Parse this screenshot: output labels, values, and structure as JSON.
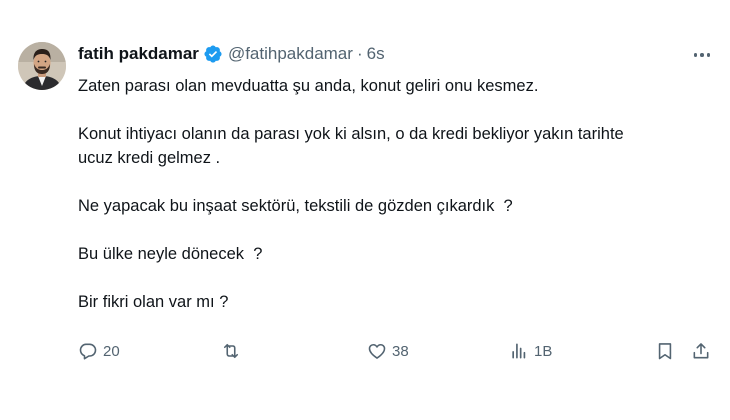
{
  "author": {
    "name": "fatih pakdamar",
    "handle": "@fatihpakdamar",
    "separator": "·",
    "time": "6s",
    "verified": true
  },
  "tweet": {
    "paragraphs": [
      "Zaten parası olan mevduatta şu anda, konut geliri onu kesmez.",
      "Konut ihtiyacı olanın da parası yok ki alsın, o da kredi bekliyor yakın tarihte\nucuz kredi gelmez .",
      "Ne yapacak bu inşaat sektörü, tekstili de gözden çıkardık  ?",
      "Bu ülke neyle dönecek  ?",
      "Bir fikri olan var mı ?"
    ]
  },
  "actions": {
    "replies": "20",
    "reposts": "",
    "likes": "38",
    "views": "1B"
  },
  "icons": {
    "verified": "verified-badge-icon",
    "more": "more-icon",
    "reply": "reply-icon",
    "repost": "repost-icon",
    "like": "like-icon",
    "views": "views-icon",
    "bookmark": "bookmark-icon",
    "share": "share-icon"
  },
  "colors": {
    "text": "#0f1419",
    "secondary": "#536471",
    "verified": "#1d9bf0",
    "background": "#ffffff"
  }
}
